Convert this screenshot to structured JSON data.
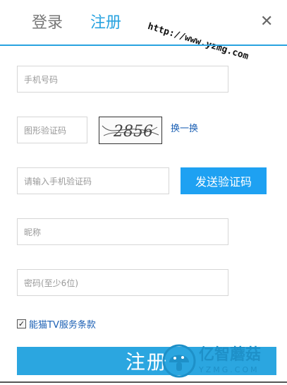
{
  "tabs": {
    "login": "登录",
    "register": "注册"
  },
  "watermark": {
    "url": "http://www.yzmg.com",
    "brand": "亿智蘑菇",
    "domain": "YZMG.COM"
  },
  "icons": {
    "close": "close-icon",
    "checkbox": "checkmark-icon",
    "logo": "mushroom-logo-icon"
  },
  "form": {
    "phone_placeholder": "手机号码",
    "captcha_placeholder": "图形验证码",
    "captcha_image_text": "2856",
    "refresh_label": "换一换",
    "sms_placeholder": "请输入手机验证码",
    "send_code_label": "发送验证码",
    "nickname_placeholder": "昵称",
    "password_placeholder": "密码(至少6位)",
    "agree_checked": true,
    "agree_label": "能猫TV服务条款",
    "submit_label": "注册"
  },
  "colors": {
    "accent": "#29a3e0",
    "button": "#1ea1f2",
    "link": "#1a5fb4"
  }
}
